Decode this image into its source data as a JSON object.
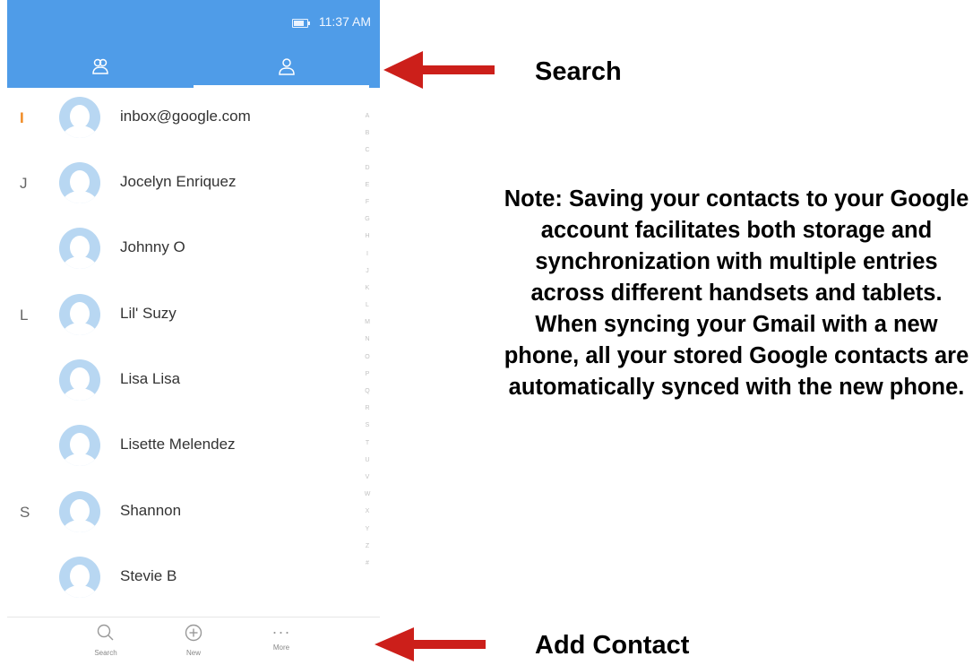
{
  "status": {
    "time": "11:37 AM"
  },
  "tabs": [
    {
      "name": "groups",
      "icon": "groups-icon"
    },
    {
      "name": "contacts",
      "icon": "person-icon",
      "active": true
    }
  ],
  "contacts": [
    {
      "letter": "I",
      "name": "inbox@google.com"
    },
    {
      "letter": "J",
      "name": "Jocelyn Enriquez"
    },
    {
      "letter": "",
      "name": "Johnny O"
    },
    {
      "letter": "L",
      "name": "Lil' Suzy"
    },
    {
      "letter": "",
      "name": "Lisa Lisa"
    },
    {
      "letter": "",
      "name": "Lisette Melendez"
    },
    {
      "letter": "S",
      "name": "Shannon"
    },
    {
      "letter": "",
      "name": "Stevie B"
    }
  ],
  "index_letters": [
    "A",
    "B",
    "C",
    "D",
    "E",
    "F",
    "G",
    "H",
    "I",
    "J",
    "K",
    "L",
    "M",
    "N",
    "O",
    "P",
    "Q",
    "R",
    "S",
    "T",
    "U",
    "V",
    "W",
    "X",
    "Y",
    "Z",
    "#"
  ],
  "bottom_bar": {
    "search_label": "Search",
    "add_label": "New",
    "more_label": "More",
    "more_glyph": "···"
  },
  "annotations": {
    "search_callout": "Search",
    "add_callout": "Add Contact",
    "note": "Note: Saving your contacts to your Google account facilitates both storage and synchronization with multiple entries across different handsets and tablets. When syncing your Gmail with a new phone, all your stored Google contacts are automatically synced with the new phone."
  },
  "colors": {
    "header": "#4f9ce8",
    "accent_letter": "#f08a24",
    "arrow": "#cc1f1a",
    "avatar": "#b8d7f2"
  }
}
